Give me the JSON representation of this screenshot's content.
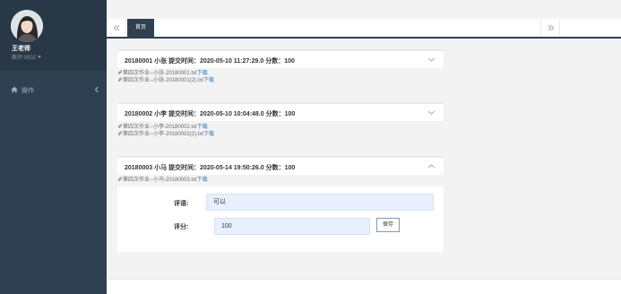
{
  "user": {
    "name": "王老师",
    "role": "教师 0002"
  },
  "nav": {
    "item_label": "操作"
  },
  "tabs": {
    "active_label": "首页"
  },
  "submissions": [
    {
      "title": "20180001 小张 提交时间：2020-05-10 11:27:29.0 分数：100",
      "files": [
        {
          "path": "第四次作业--小张-20180001.txt",
          "action": "下载"
        },
        {
          "path": "第四次作业--小张-20180001(2).txt",
          "action": "下载"
        }
      ]
    },
    {
      "title": "20180002 小李 提交时间：2020-05-10 10:04:48.0 分数：100",
      "files": [
        {
          "path": "第四次作业--小李-20180002.txt",
          "action": "下载"
        },
        {
          "path": "第四次作业--小李-20180002(2).txt",
          "action": "下载"
        }
      ]
    },
    {
      "title": "20180003 小马 提交时间：2020-05-14 19:50:26.0 分数：100",
      "files": [
        {
          "path": "第四次作业--小马-20180003.txt",
          "action": "下载"
        }
      ]
    }
  ],
  "review": {
    "comment_label": "评语:",
    "comment_value": "可以",
    "score_label": "评分:",
    "score_value": "100",
    "save_label": "保存"
  },
  "colors": {
    "sidebar": "#2f4050",
    "profile": "#293846",
    "link": "#337ab7",
    "input_bg": "#e8f0fe"
  }
}
